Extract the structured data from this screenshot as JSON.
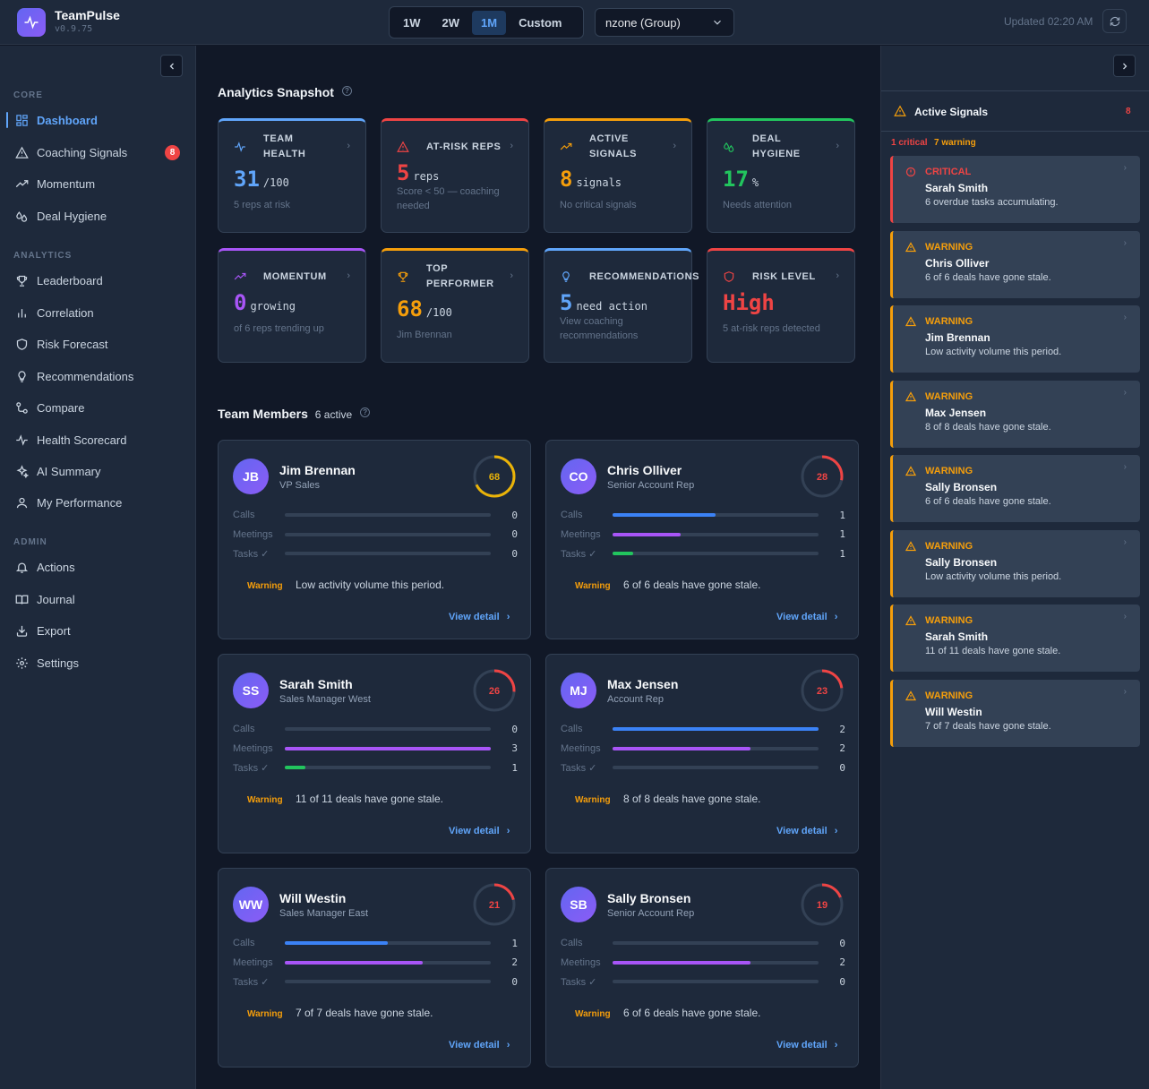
{
  "app": {
    "name": "TeamPulse",
    "version": "v0.9.75"
  },
  "header": {
    "ranges": [
      "1W",
      "2W",
      "1M",
      "Custom"
    ],
    "active_range": "1M",
    "group": "nzone (Group)",
    "updated": "Updated 02:20 AM"
  },
  "sidebar": {
    "sections": [
      {
        "label": "CORE",
        "items": [
          {
            "label": "Dashboard",
            "icon": "grid-icon",
            "active": true
          },
          {
            "label": "Coaching Signals",
            "icon": "warning-icon",
            "badge": "8"
          },
          {
            "label": "Momentum",
            "icon": "trend-icon"
          },
          {
            "label": "Deal Hygiene",
            "icon": "droplets-icon"
          }
        ]
      },
      {
        "label": "ANALYTICS",
        "items": [
          {
            "label": "Leaderboard",
            "icon": "trophy-icon"
          },
          {
            "label": "Correlation",
            "icon": "bar-chart-icon"
          },
          {
            "label": "Risk Forecast",
            "icon": "shield-icon"
          },
          {
            "label": "Recommendations",
            "icon": "lightbulb-icon"
          },
          {
            "label": "Compare",
            "icon": "compare-icon"
          },
          {
            "label": "Health Scorecard",
            "icon": "activity-icon"
          },
          {
            "label": "AI Summary",
            "icon": "sparkles-icon"
          },
          {
            "label": "My Performance",
            "icon": "user-icon"
          }
        ]
      },
      {
        "label": "ADMIN",
        "items": [
          {
            "label": "Actions",
            "icon": "bell-icon"
          },
          {
            "label": "Journal",
            "icon": "book-icon"
          },
          {
            "label": "Export",
            "icon": "download-icon"
          },
          {
            "label": "Settings",
            "icon": "gear-icon"
          }
        ]
      }
    ]
  },
  "snapshot": {
    "title": "Analytics Snapshot",
    "help": "?",
    "kpis": [
      {
        "title_lines": [
          "TEAM",
          "HEALTH"
        ],
        "value": "31",
        "unit": "/100",
        "sub": "5 reps at risk",
        "color": "#60a5fa",
        "icon": "activity-icon"
      },
      {
        "title_lines": [
          "AT-RISK REPS"
        ],
        "value": "5",
        "unit": "reps",
        "sub": "Score < 50 — coaching needed",
        "color": "#ef4444",
        "icon": "warning-icon"
      },
      {
        "title_lines": [
          "ACTIVE",
          "SIGNALS"
        ],
        "value": "8",
        "unit": "signals",
        "sub": "No critical signals",
        "color": "#f59e0b",
        "icon": "trend-icon"
      },
      {
        "title_lines": [
          "DEAL",
          "HYGIENE"
        ],
        "value": "17",
        "unit": "%",
        "sub": "Needs attention",
        "color": "#22c55e",
        "icon": "droplets-icon"
      },
      {
        "title_lines": [
          "MOMENTUM"
        ],
        "value": "0",
        "unit": "growing",
        "sub": "of 6 reps trending up",
        "color": "#a855f7",
        "icon": "trend-icon"
      },
      {
        "title_lines": [
          "TOP",
          "PERFORMER"
        ],
        "value": "68",
        "unit": "/100",
        "sub": "Jim Brennan",
        "color": "#f59e0b",
        "icon": "trophy-icon"
      },
      {
        "title_lines": [
          "RECOMMENDATIONS"
        ],
        "value": "5",
        "unit": "need action",
        "sub": "View coaching recommendations",
        "color": "#60a5fa",
        "icon": "lightbulb-icon"
      },
      {
        "title_lines": [
          "RISK LEVEL"
        ],
        "value": "High",
        "unit": "",
        "sub": "5 at-risk reps detected",
        "color": "#ef4444",
        "icon": "shield-icon"
      }
    ]
  },
  "team": {
    "title": "Team Members",
    "count": "6 active",
    "metric_labels": [
      "Calls",
      "Meetings",
      "Tasks ✓"
    ],
    "warning_label": "Warning",
    "link_label": "View detail",
    "members": [
      {
        "initials": "JB",
        "name": "Jim Brennan",
        "role": "VP Sales",
        "score": 68,
        "score_color": "#eab308",
        "calls": 0,
        "meetings": 0,
        "tasks": 0,
        "calls_fill": 0,
        "meetings_fill": 0,
        "tasks_fill": 0,
        "message": "Low activity volume this period."
      },
      {
        "initials": "CO",
        "name": "Chris Olliver",
        "role": "Senior Account Rep",
        "score": 28,
        "score_color": "#ef4444",
        "calls": 1,
        "meetings": 1,
        "tasks": 1,
        "calls_fill": 0.5,
        "meetings_fill": 0.33,
        "tasks_fill": 0.1,
        "message": "6 of 6 deals have gone stale."
      },
      {
        "initials": "SS",
        "name": "Sarah Smith",
        "role": "Sales Manager West",
        "score": 26,
        "score_color": "#ef4444",
        "calls": 0,
        "meetings": 3,
        "tasks": 1,
        "calls_fill": 0,
        "meetings_fill": 1.0,
        "tasks_fill": 0.1,
        "message": "11 of 11 deals have gone stale."
      },
      {
        "initials": "MJ",
        "name": "Max Jensen",
        "role": "Account Rep",
        "score": 23,
        "score_color": "#ef4444",
        "calls": 2,
        "meetings": 2,
        "tasks": 0,
        "calls_fill": 1.0,
        "meetings_fill": 0.67,
        "tasks_fill": 0,
        "message": "8 of 8 deals have gone stale."
      },
      {
        "initials": "WW",
        "name": "Will Westin",
        "role": "Sales Manager East",
        "score": 21,
        "score_color": "#ef4444",
        "calls": 1,
        "meetings": 2,
        "tasks": 0,
        "calls_fill": 0.5,
        "meetings_fill": 0.67,
        "tasks_fill": 0,
        "message": "7 of 7 deals have gone stale."
      },
      {
        "initials": "SB",
        "name": "Sally Bronsen",
        "role": "Senior Account Rep",
        "score": 19,
        "score_color": "#ef4444",
        "calls": 0,
        "meetings": 2,
        "tasks": 0,
        "calls_fill": 0,
        "meetings_fill": 0.67,
        "tasks_fill": 0,
        "message": "6 of 6 deals have gone stale."
      }
    ]
  },
  "signals_panel": {
    "title": "Active Signals",
    "count": "8",
    "critical_summary": "1 critical",
    "warning_summary": "7 warning",
    "items": [
      {
        "type": "CRITICAL",
        "name": "Sarah Smith",
        "message": "6 overdue tasks accumulating."
      },
      {
        "type": "WARNING",
        "name": "Chris Olliver",
        "message": "6 of 6 deals have gone stale."
      },
      {
        "type": "WARNING",
        "name": "Jim Brennan",
        "message": "Low activity volume this period."
      },
      {
        "type": "WARNING",
        "name": "Max Jensen",
        "message": "8 of 8 deals have gone stale."
      },
      {
        "type": "WARNING",
        "name": "Sally Bronsen",
        "message": "6 of 6 deals have gone stale."
      },
      {
        "type": "WARNING",
        "name": "Sally Bronsen",
        "message": "Low activity volume this period."
      },
      {
        "type": "WARNING",
        "name": "Sarah Smith",
        "message": "11 of 11 deals have gone stale."
      },
      {
        "type": "WARNING",
        "name": "Will Westin",
        "message": "7 of 7 deals have gone stale."
      }
    ]
  }
}
